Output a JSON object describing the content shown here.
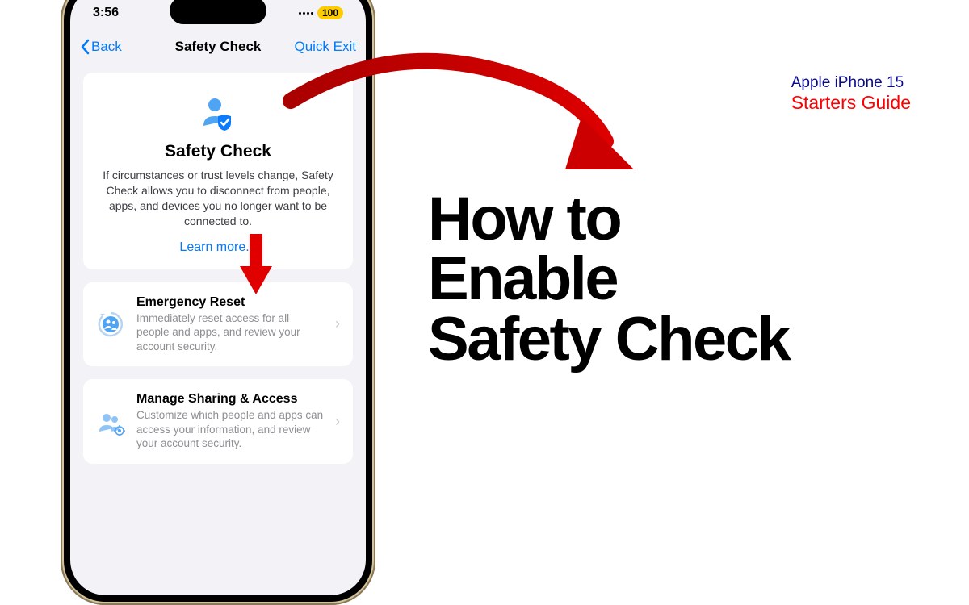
{
  "status": {
    "time": "3:56",
    "battery": "100"
  },
  "nav": {
    "back": "Back",
    "title": "Safety Check",
    "quick_exit": "Quick Exit"
  },
  "hero": {
    "title": "Safety Check",
    "description": "If circumstances or trust levels change, Safety Check allows you to disconnect from people, apps, and devices you no longer want to be connected to.",
    "learn_more": "Learn more..."
  },
  "actions": {
    "emergency": {
      "title": "Emergency Reset",
      "description": "Immediately reset access for all people and apps, and review your account security."
    },
    "manage": {
      "title": "Manage Sharing & Access",
      "description": "Customize which people and apps can access your information, and review your account security."
    }
  },
  "guide": {
    "line1": "Apple iPhone 15",
    "line2": "Starters Guide"
  },
  "headline": {
    "line1": "How to",
    "line2": "Enable",
    "line3": "Safety Check"
  }
}
